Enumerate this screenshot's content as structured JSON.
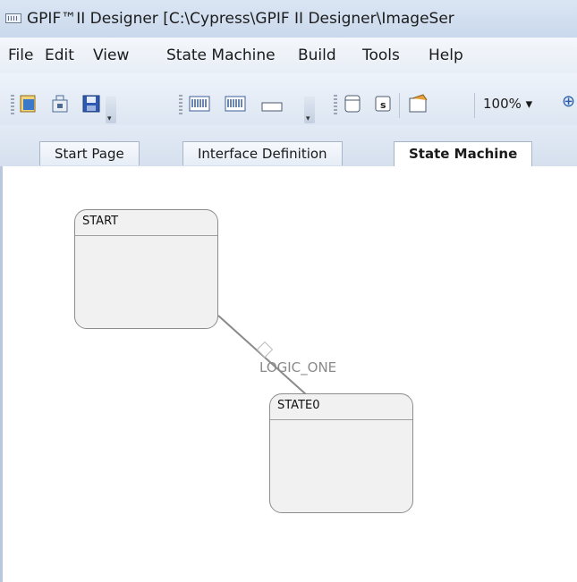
{
  "window": {
    "title": "GPIF™II Designer [C:\\Cypress\\GPIF II Designer\\ImageSer"
  },
  "menu": {
    "items": [
      "File",
      "Edit",
      "View",
      "State Machine",
      "Build",
      "Tools",
      "Help"
    ]
  },
  "toolbar": {
    "zoom_value": "100%",
    "icons": [
      "new-project-icon",
      "open-project-icon",
      "save-icon",
      "bus-width-icon",
      "bus-config-icon",
      "signal-icon",
      "state-icon",
      "state-s-icon",
      "notepad-icon",
      "zoom-in-icon"
    ]
  },
  "tabs": [
    {
      "label": "Start Page",
      "active": false
    },
    {
      "label": "Interface Definition",
      "active": false
    },
    {
      "label": "State Machine",
      "active": true
    }
  ],
  "canvas": {
    "states": [
      {
        "name": "START"
      },
      {
        "name": "STATE0"
      }
    ],
    "transitions": [
      {
        "from": "START",
        "to": "STATE0",
        "label": "LOGIC_ONE"
      }
    ]
  },
  "colors": {
    "title_bar": "#c9d8ec",
    "state_border": "#8d8d8d",
    "state_fill": "#f1f1f1",
    "transition_line": "#8a8a8a"
  }
}
